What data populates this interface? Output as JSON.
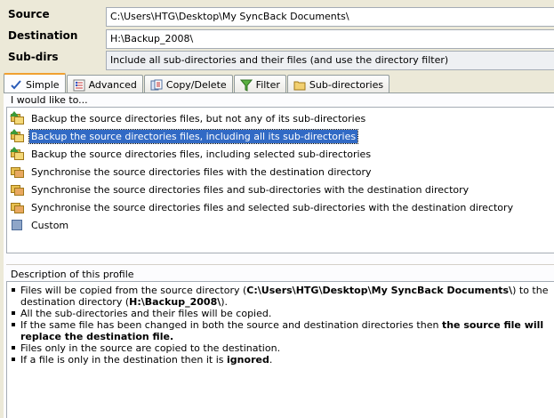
{
  "form": {
    "source_label": "Source",
    "source_value": "C:\\Users\\HTG\\Desktop\\My SyncBack Documents\\",
    "destination_label": "Destination",
    "destination_value": "H:\\Backup_2008\\",
    "subdirs_label": "Sub-dirs",
    "subdirs_value": "Include all sub-directories and their files (and use the directory filter)"
  },
  "tabs": [
    {
      "label": "Simple",
      "icon": "simple-icon",
      "active": true
    },
    {
      "label": "Advanced",
      "icon": "advanced-icon"
    },
    {
      "label": "Copy/Delete",
      "icon": "copy-delete-icon"
    },
    {
      "label": "Filter",
      "icon": "filter-icon"
    },
    {
      "label": "Sub-directories",
      "icon": "folder-icon"
    }
  ],
  "options": {
    "title": "I would like to...",
    "items": [
      {
        "label": "Backup the source directories files, but not any of its sub-directories",
        "icon": "backup-folder-icon"
      },
      {
        "label": "Backup the source directories files, including all its sub-directories",
        "icon": "backup-folder-icon",
        "selected": true
      },
      {
        "label": "Backup the source directories files, including selected sub-directories",
        "icon": "backup-folder-icon"
      },
      {
        "label": "Synchronise the source directories files with the destination directory",
        "icon": "sync-folder-icon"
      },
      {
        "label": "Synchronise the source directories files and sub-directories with the destination directory",
        "icon": "sync-folder-icon"
      },
      {
        "label": "Synchronise the source directories files and selected sub-directories with the destination directory",
        "icon": "sync-folder-icon"
      },
      {
        "label": "Custom",
        "icon": "custom-icon"
      }
    ]
  },
  "description": {
    "title": "Description of this profile",
    "b1_a": "Files will be copied from the source directory (",
    "b1_b": "C:\\Users\\HTG\\Desktop\\My SyncBack Documents\\",
    "b1_c": ") to the destination directory (",
    "b1_d": "H:\\Backup_2008\\",
    "b1_e": ").",
    "b2": "All the sub-directories and their files will be copied.",
    "b3_a": "If the same file has been changed in both the source and destination directories then ",
    "b3_b": "the source file will replace the destination file.",
    "b4": "Files only in the source are copied to the destination.",
    "b5_a": "If a file is only in the destination then it is ",
    "b5_b": "ignored",
    "b5_c": "."
  },
  "colors": {
    "selection": "#316ac5",
    "tab_accent": "#f0a030",
    "background": "#ece9d8"
  }
}
